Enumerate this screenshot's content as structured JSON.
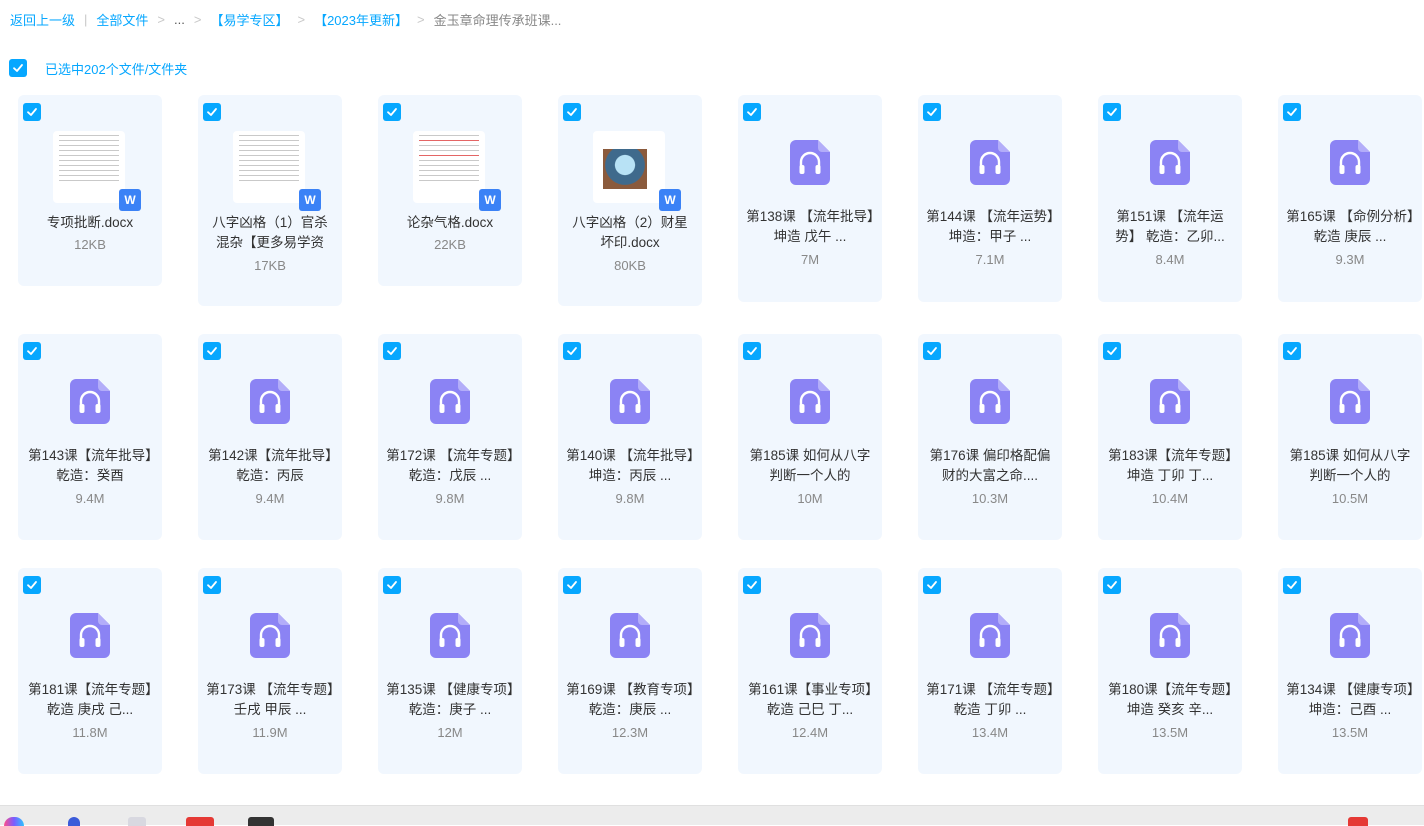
{
  "breadcrumb": {
    "items": [
      "返回上一级",
      "全部文件",
      "...",
      "【易学专区】",
      "【2023年更新】",
      "金玉章命理传承班课..."
    ]
  },
  "selection": {
    "text": "已选中202个文件/文件夹",
    "checked": true
  },
  "colors": {
    "accent": "#06a7ff",
    "card_bg": "#f1f7fe",
    "audio_icon": "#8b83f4",
    "word_badge": "#3b82f6"
  },
  "files": [
    {
      "type": "doc",
      "icon": "word-doc-icon",
      "name": "专项批断.docx",
      "size": "12KB",
      "checked": true
    },
    {
      "type": "doc",
      "icon": "word-doc-icon",
      "name": "八字凶格（1）官杀混杂【更多易学资",
      "size": "17KB",
      "checked": true
    },
    {
      "type": "doc",
      "icon": "word-doc-icon",
      "name": "论杂气格.docx",
      "size": "22KB",
      "checked": true
    },
    {
      "type": "doc",
      "icon": "word-doc-icon",
      "name": "八字凶格（2）财星坏印.docx",
      "size": "80KB",
      "checked": true
    },
    {
      "type": "audio",
      "icon": "audio-file-icon",
      "name": "第138课 【流年批导】坤造 戊午 ...",
      "size": "7M",
      "checked": true
    },
    {
      "type": "audio",
      "icon": "audio-file-icon",
      "name": "第144课 【流年运势】坤造：甲子 ...",
      "size": "7.1M",
      "checked": true
    },
    {
      "type": "audio",
      "icon": "audio-file-icon",
      "name": "第151课 【流年运势】 乾造：乙卯...",
      "size": "8.4M",
      "checked": true
    },
    {
      "type": "audio",
      "icon": "audio-file-icon",
      "name": "第165课 【命例分析】乾造 庚辰 ...",
      "size": "9.3M",
      "checked": true
    },
    {
      "type": "audio",
      "icon": "audio-file-icon",
      "name": "第143课【流年批导】乾造：癸酉",
      "size": "9.4M",
      "checked": true
    },
    {
      "type": "audio",
      "icon": "audio-file-icon",
      "name": "第142课【流年批导】乾造：丙辰",
      "size": "9.4M",
      "checked": true
    },
    {
      "type": "audio",
      "icon": "audio-file-icon",
      "name": "第172课 【流年专题】乾造：戊辰 ...",
      "size": "9.8M",
      "checked": true
    },
    {
      "type": "audio",
      "icon": "audio-file-icon",
      "name": "第140课 【流年批导】坤造：丙辰 ...",
      "size": "9.8M",
      "checked": true
    },
    {
      "type": "audio",
      "icon": "audio-file-icon",
      "name": "第185课 如何从八字判断一个人的",
      "size": "10M",
      "checked": true
    },
    {
      "type": "audio",
      "icon": "audio-file-icon",
      "name": "第176课 偏印格配偏财的大富之命....",
      "size": "10.3M",
      "checked": true
    },
    {
      "type": "audio",
      "icon": "audio-file-icon",
      "name": "第183课【流年专题】坤造 丁卯 丁...",
      "size": "10.4M",
      "checked": true
    },
    {
      "type": "audio",
      "icon": "audio-file-icon",
      "name": "第185课 如何从八字判断一个人的",
      "size": "10.5M",
      "checked": true
    },
    {
      "type": "audio",
      "icon": "audio-file-icon",
      "name": "第181课【流年专题】乾造 庚戌 己...",
      "size": "11.8M",
      "checked": true
    },
    {
      "type": "audio",
      "icon": "audio-file-icon",
      "name": "第173课 【流年专题】壬戌 甲辰 ...",
      "size": "11.9M",
      "checked": true
    },
    {
      "type": "audio",
      "icon": "audio-file-icon",
      "name": "第135课 【健康专项】乾造：庚子 ...",
      "size": "12M",
      "checked": true
    },
    {
      "type": "audio",
      "icon": "audio-file-icon",
      "name": "第169课 【教育专项】乾造：庚辰 ...",
      "size": "12.3M",
      "checked": true
    },
    {
      "type": "audio",
      "icon": "audio-file-icon",
      "name": "第161课【事业专项】乾造 己巳 丁...",
      "size": "12.4M",
      "checked": true
    },
    {
      "type": "audio",
      "icon": "audio-file-icon",
      "name": "第171课 【流年专题】乾造 丁卯 ...",
      "size": "13.4M",
      "checked": true
    },
    {
      "type": "audio",
      "icon": "audio-file-icon",
      "name": "第180课【流年专题】坤造 癸亥 辛...",
      "size": "13.5M",
      "checked": true
    },
    {
      "type": "audio",
      "icon": "audio-file-icon",
      "name": "第134课 【健康专项】坤造：己酉 ...",
      "size": "13.5M",
      "checked": true
    }
  ],
  "taskbar": {
    "icons": [
      "start-orb-icon",
      "app-icon",
      "document-app-icon",
      "wps-app-icon",
      "terminal-icon",
      "tray-app-icon"
    ]
  }
}
